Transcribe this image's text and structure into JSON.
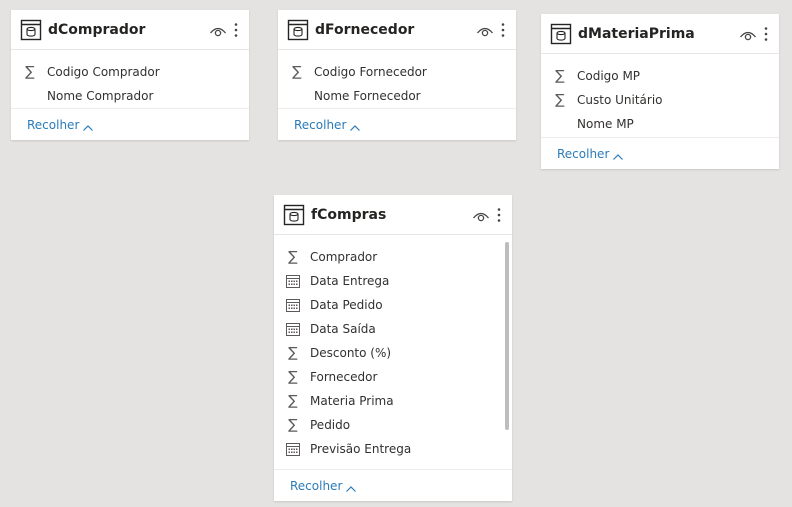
{
  "tables": [
    {
      "title": "dComprador",
      "fields": [
        {
          "label": "Codigo Comprador",
          "icon": "sigma-icon"
        },
        {
          "label": "Nome Comprador",
          "icon": "none"
        }
      ],
      "collapse_label": "Recolher"
    },
    {
      "title": "dFornecedor",
      "fields": [
        {
          "label": "Codigo Fornecedor",
          "icon": "sigma-icon"
        },
        {
          "label": "Nome Fornecedor",
          "icon": "none"
        }
      ],
      "collapse_label": "Recolher"
    },
    {
      "title": "dMateriaPrima",
      "fields": [
        {
          "label": "Codigo MP",
          "icon": "sigma-icon"
        },
        {
          "label": "Custo Unitário",
          "icon": "sigma-icon"
        },
        {
          "label": "Nome MP",
          "icon": "none"
        }
      ],
      "collapse_label": "Recolher"
    },
    {
      "title": "fCompras",
      "fields": [
        {
          "label": "Comprador",
          "icon": "sigma-icon"
        },
        {
          "label": "Data Entrega",
          "icon": "calendar-icon"
        },
        {
          "label": "Data Pedido",
          "icon": "calendar-icon"
        },
        {
          "label": "Data Saída",
          "icon": "calendar-icon"
        },
        {
          "label": "Desconto (%)",
          "icon": "sigma-icon"
        },
        {
          "label": "Fornecedor",
          "icon": "sigma-icon"
        },
        {
          "label": "Materia Prima",
          "icon": "sigma-icon"
        },
        {
          "label": "Pedido",
          "icon": "sigma-icon"
        },
        {
          "label": "Previsão Entrega",
          "icon": "calendar-icon"
        }
      ],
      "collapse_label": "Recolher"
    }
  ],
  "colors": {
    "canvas": "#e4e3e1",
    "card": "#ffffff",
    "link": "#2b7bb9",
    "text": "#323130"
  }
}
